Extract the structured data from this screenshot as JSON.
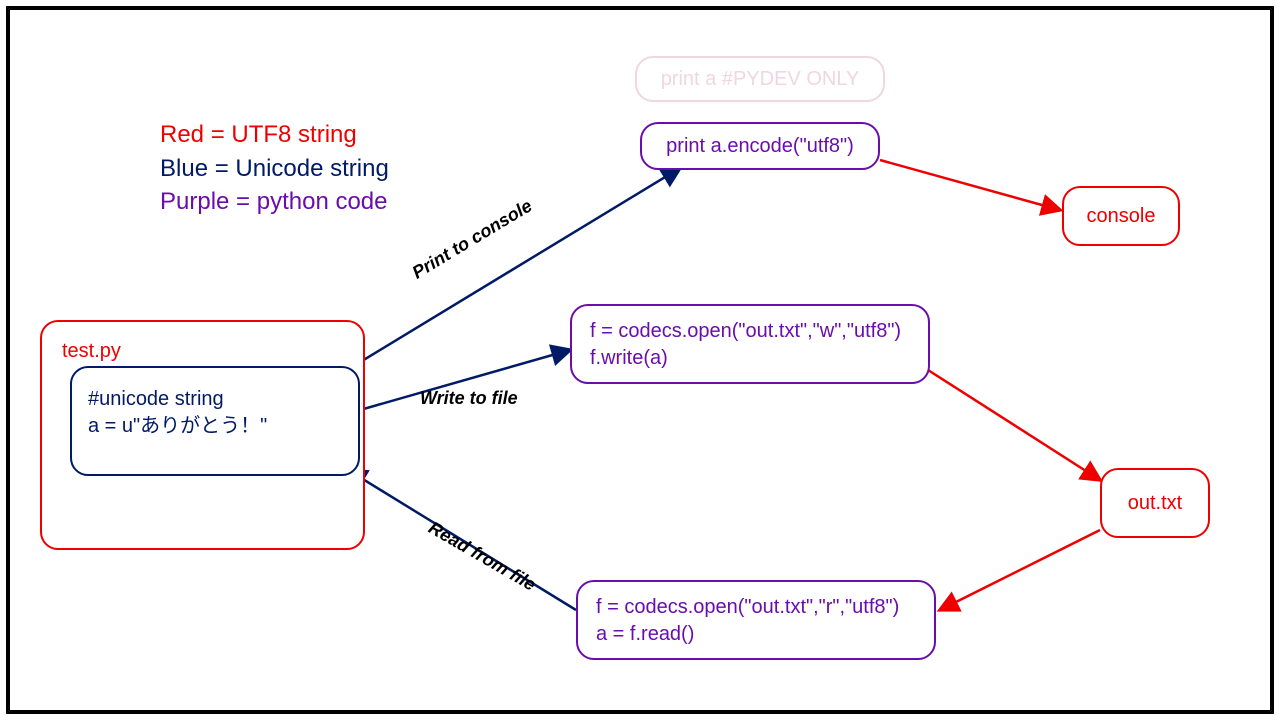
{
  "legend": {
    "red": "Red = UTF8 string",
    "blue": "Blue = Unicode string",
    "purple": "Purple = python code"
  },
  "nodes": {
    "testpy_title": "test.py",
    "source_comment": "#unicode string",
    "source_code": "a = u\"ありがとう！\"",
    "pydev_box": "print a #PYDEV ONLY",
    "encode_box": "print a.encode(\"utf8\")",
    "console_box": "console",
    "write_line1": "f = codecs.open(\"out.txt\",\"w\",\"utf8\")",
    "write_line2": "f.write(a)",
    "out_box": "out.txt",
    "read_line1": "f = codecs.open(\"out.txt\",\"r\",\"utf8\")",
    "read_line2": "a = f.read()"
  },
  "edges": {
    "print_to_console": "Print to console",
    "write_to_file": "Write to file",
    "read_from_file": "Read from file"
  },
  "colors": {
    "red": "#ee0000",
    "blue": "#001a66",
    "purple": "#6a0dad",
    "faint": "#f0d6e1"
  }
}
